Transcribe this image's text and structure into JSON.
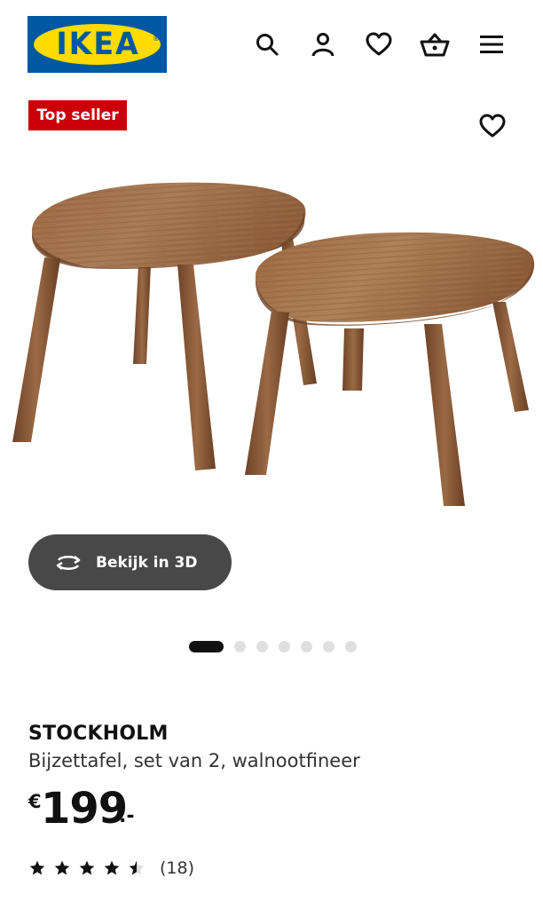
{
  "header": {
    "logo_text": "IKEA",
    "logo_colors": {
      "blue": "#0058a3",
      "yellow": "#ffdb00"
    },
    "icons": [
      "search-icon",
      "account-icon",
      "heart-icon",
      "basket-icon",
      "hamburger-menu-icon"
    ]
  },
  "badge": {
    "label": "Top seller",
    "color": "#cc0008"
  },
  "product_image": {
    "description": "two nesting side tables in walnut veneer",
    "favorite_icon": "heart-icon"
  },
  "view3d": {
    "label": "Bekijk in 3D",
    "icon": "rotate-3d-icon"
  },
  "carousel": {
    "total": 7,
    "active_index": 0
  },
  "product": {
    "name": "STOCKHOLM",
    "description": "Bijzettafel, set van 2, walnootfineer",
    "price": {
      "currency": "€",
      "integer": "199",
      "suffix": ".-"
    },
    "rating": {
      "stars": 4.5,
      "max": 5,
      "count_label": "(18)"
    }
  }
}
